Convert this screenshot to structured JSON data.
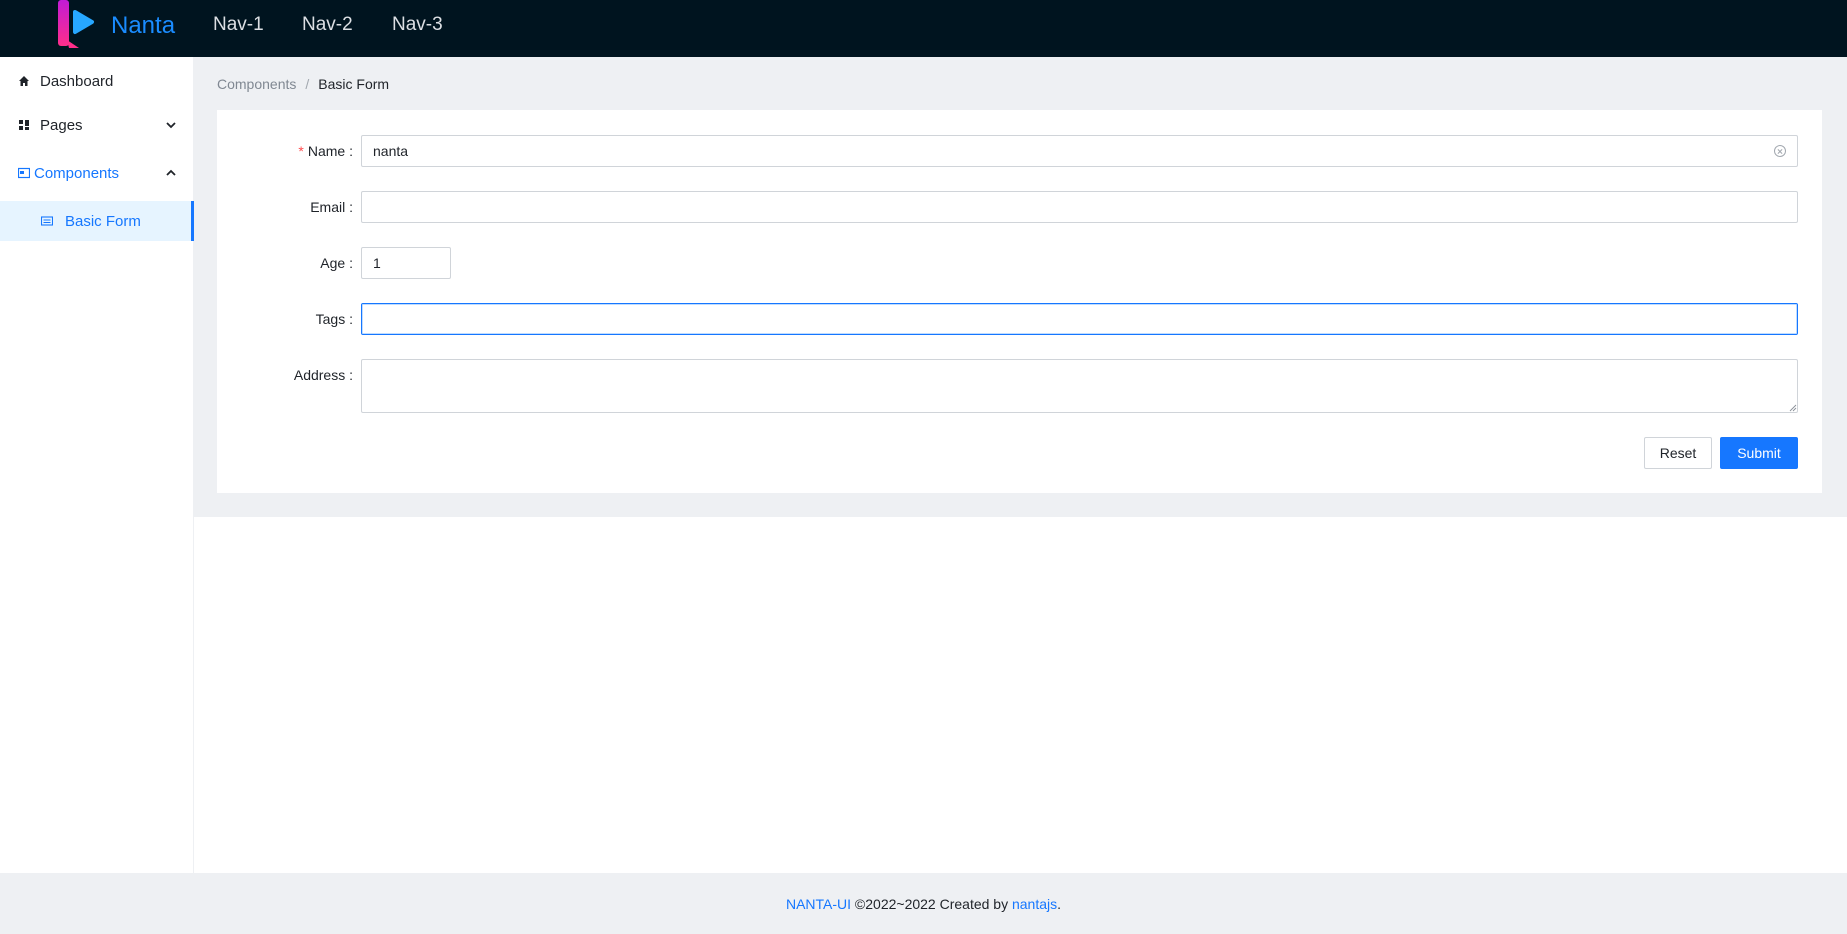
{
  "header": {
    "brand": "Nanta",
    "nav": [
      "Nav-1",
      "Nav-2",
      "Nav-3"
    ]
  },
  "sidebar": {
    "items": [
      {
        "label": "Dashboard",
        "icon": "home-icon"
      },
      {
        "label": "Pages",
        "icon": "grid-icon",
        "expanded": false
      },
      {
        "label": "Components",
        "icon": "layout-icon",
        "expanded": true
      },
      {
        "label": "Basic Form",
        "icon": "form-icon",
        "active": true
      }
    ]
  },
  "breadcrumb": {
    "parent": "Components",
    "separator": "/",
    "current": "Basic Form"
  },
  "form": {
    "name_label": "Name",
    "name_value": "nanta",
    "email_label": "Email",
    "email_value": "",
    "age_label": "Age",
    "age_value": "1",
    "tags_label": "Tags",
    "tags_value": "",
    "address_label": "Address",
    "address_value": "",
    "reset_label": "Reset",
    "submit_label": "Submit"
  },
  "footer": {
    "brand_link": "NANTA-UI",
    "text": " ©2022~2022 Created by ",
    "author_link": "nantajs",
    "end": "."
  },
  "colors": {
    "header_bg": "#00141f",
    "accent": "#1677ff",
    "content_bg": "#eef0f3"
  }
}
